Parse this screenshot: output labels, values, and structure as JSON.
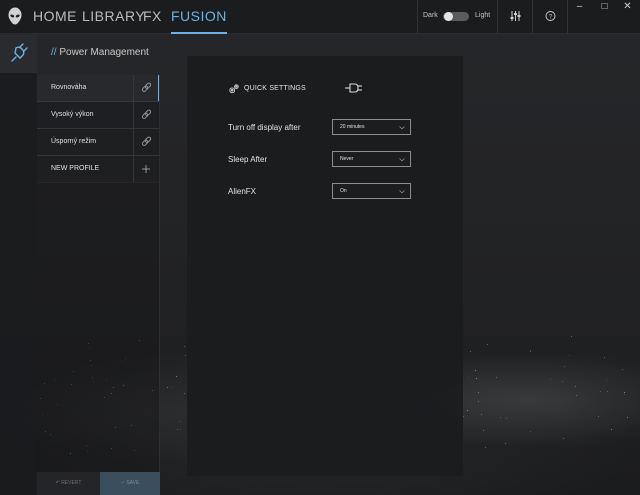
{
  "nav": {
    "tabs": [
      {
        "label": "HOME"
      },
      {
        "label": "LIBRARY"
      },
      {
        "label": "FX"
      },
      {
        "label": "FUSION"
      }
    ],
    "active_tab": "FUSION"
  },
  "theme": {
    "dark_label": "Dark",
    "light_label": "Light",
    "mode": "Dark"
  },
  "toolbar": {
    "mixer_icon": "sliders-icon",
    "help_icon": "help-icon"
  },
  "window": {
    "minimize": "–",
    "maximize": "□",
    "close": "✕"
  },
  "panel": {
    "slashes": "//",
    "title": "Power Management",
    "profiles": [
      {
        "label": "Rovnováha",
        "action_icon": "link-icon"
      },
      {
        "label": "Vysoký výkon",
        "action_icon": "link-icon"
      },
      {
        "label": "Úsporný režim",
        "action_icon": "link-icon"
      },
      {
        "label": "NEW PROFILE",
        "action_icon": "plus-icon"
      }
    ],
    "revert_label": "REVERT",
    "save_label": "SAVE"
  },
  "quick_settings": {
    "title": "QUICK SETTINGS",
    "rows": [
      {
        "label": "Turn off display after",
        "value": "20 minutes"
      },
      {
        "label": "Sleep After",
        "value": "Never"
      },
      {
        "label": "AlienFX",
        "value": "On"
      }
    ]
  },
  "colors": {
    "accent": "#6ab3e8",
    "background": "#1e1f21"
  }
}
